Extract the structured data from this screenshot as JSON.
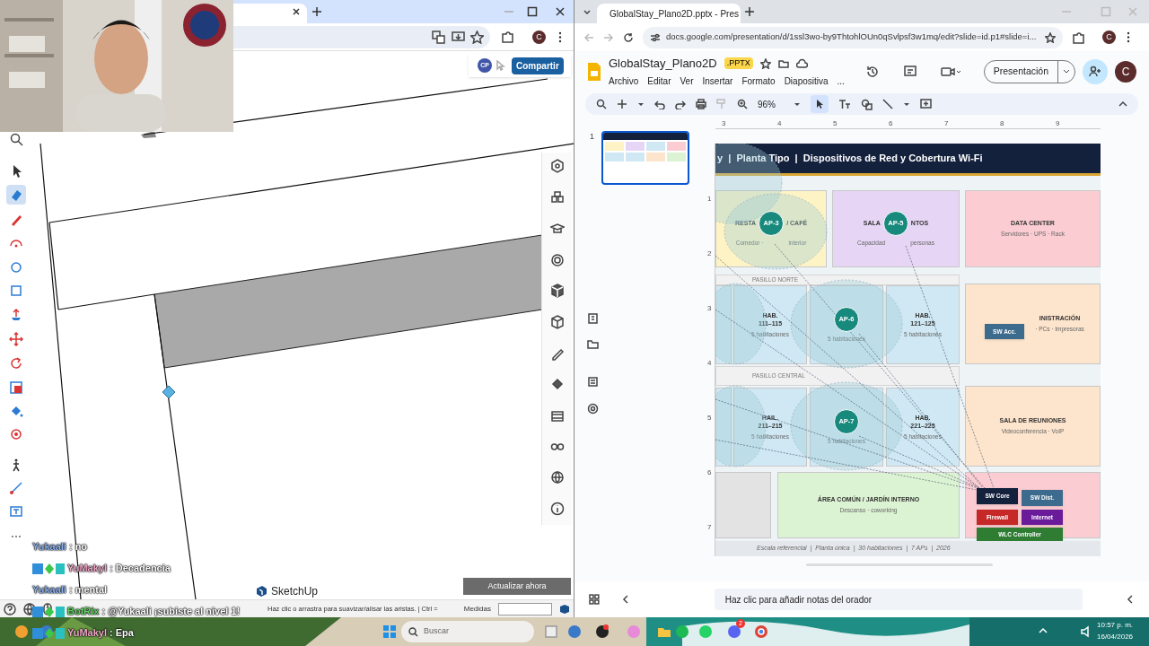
{
  "sketchup": {
    "avatar": "C",
    "share_avatar": "CP",
    "share_button": "Compartir",
    "logo_text": "SketchUp",
    "update_button": "Actualizar ahora",
    "status_text": "Haz clic o arrastra para suavizar/alisar las aristas. | Ctrl =",
    "measurements_label": "Medidas"
  },
  "chat": [
    {
      "user": "Yukaali",
      "message": ": no",
      "color": "#8fb4f0",
      "badges": false
    },
    {
      "user": "YuMakyl",
      "message": ": Decadencia",
      "color": "#f0a8c8",
      "badges": true
    },
    {
      "user": "Yukaali",
      "message": ": mental",
      "color": "#8fb4f0",
      "badges": false
    },
    {
      "user": "BotRix",
      "message": ": @Yukaali ¡subiste al nivel 1!",
      "color": "#5fd35f",
      "badges": true
    },
    {
      "user": "YuMakyl",
      "message": ": Epa",
      "color": "#f0a8c8",
      "badges": true
    }
  ],
  "slides_window": {
    "tab_title": "GlobalStay_Plano2D.pptx - Pres",
    "url": "docs.google.com/presentation/d/1ssl3wo-by9ThtohlOUn0qSvlpsf3w1mq/edit?slide=id.p1#slide=i...",
    "avatar": "C"
  },
  "slides_app": {
    "title": "GlobalStay_Plano2D",
    "file_badge": ".PPTX",
    "menus": [
      "Archivo",
      "Editar",
      "Ver",
      "Insertar",
      "Formato",
      "Diapositiva"
    ],
    "menu_more": "...",
    "present_button": "Presentación",
    "avatar": "C",
    "zoom": "96%",
    "thumbnail_number": "1",
    "ruler_h": [
      "3",
      "4",
      "5",
      "6",
      "7",
      "8",
      "9"
    ],
    "ruler_v": [
      "1",
      "2",
      "3",
      "4",
      "5",
      "6",
      "7"
    ],
    "notes_placeholder": "Haz clic para añadir notas del orador"
  },
  "slide": {
    "title": "y  |  Planta Tipo  |  Dispositivos de Red y Cobertura Wi-Fi",
    "rooms": [
      {
        "kind": "split",
        "name": [
          "RESTA",
          "/ CAFÉ"
        ],
        "note": [
          "Comedor ·",
          "interior"
        ],
        "color": "#fdf3c4"
      },
      {
        "kind": "split",
        "name": [
          "SALA",
          "NTOS"
        ],
        "note": [
          "Capacidad",
          "personas"
        ],
        "color": "#e6d5f5"
      },
      {
        "kind": "stack",
        "name": [
          "DATA CENTER"
        ],
        "note": [
          "Servidores · UPS · Rack"
        ],
        "color": "#fbcdd2"
      },
      {
        "kind": "stack",
        "color": "#cfe8f3"
      },
      {
        "kind": "stack",
        "name": [
          "HAB.",
          "111–115"
        ],
        "note": [
          "5 habitaciones"
        ],
        "color": "#cfe8f3"
      },
      {
        "kind": "stack",
        "note": [
          "5 habitaciones"
        ],
        "color": "#cfe8f3"
      },
      {
        "kind": "stack",
        "name": [
          "HAB.",
          "121–125"
        ],
        "note": [
          "5 habitaciones"
        ],
        "color": "#cfe8f3"
      },
      {
        "kind": "stack",
        "name": [
          "INISTRACIÓN"
        ],
        "note": [
          "· PCs · Impresoras"
        ],
        "color": "#fde4cc"
      },
      {
        "kind": "stack",
        "color": "#cfe8f3"
      },
      {
        "kind": "stack",
        "name": [
          "HAIL.",
          "211–215"
        ],
        "note": [
          "5 habitaciones"
        ],
        "color": "#cfe8f3"
      },
      {
        "kind": "stack",
        "note": [
          "5 habitaciones"
        ],
        "color": "#cfe8f3"
      },
      {
        "kind": "stack",
        "name": [
          "HAB.",
          "221–225"
        ],
        "note": [
          "5 habitaciones"
        ],
        "color": "#cfe8f3"
      },
      {
        "kind": "stack",
        "name": [
          "SALA DE REUNIONES"
        ],
        "note": [
          "Videoconferencia · VoIP"
        ],
        "color": "#fde4cc"
      },
      {
        "kind": "stack",
        "color": "#e3e3e3"
      },
      {
        "kind": "stack",
        "name": [
          "ÁREA COMÚN / JARDÍN INTERNO"
        ],
        "note": [
          "Descanso · coworking"
        ],
        "color": "#dcf3d3"
      },
      {
        "kind": "stack",
        "color": "#fbcdd2"
      }
    ],
    "corridors": [
      "PASILLO NORTE",
      "PASILLO CENTRAL"
    ],
    "access_points": [
      "AP-3",
      "AP-5",
      "AP-6",
      "AP-7"
    ],
    "devices": [
      {
        "label": "SW Acc.",
        "color": "#3d6b8e"
      },
      {
        "label": "SW Core",
        "color": "#14213d"
      },
      {
        "label": "SW Dist.",
        "color": "#3d6b8e"
      },
      {
        "label": "Firewall",
        "color": "#c62828"
      },
      {
        "label": "Internet",
        "color": "#6a1b9a"
      },
      {
        "label": "WLC Controller",
        "color": "#2e7d32"
      }
    ],
    "footer": "Escala referencial  |  Planta única  |  30 habitaciones  |  7 APs  |  2026"
  },
  "taskbar": {
    "search_placeholder": "Buscar",
    "discord_badge": "2",
    "time": "10:57 p. m.",
    "date": "16/04/2026"
  }
}
